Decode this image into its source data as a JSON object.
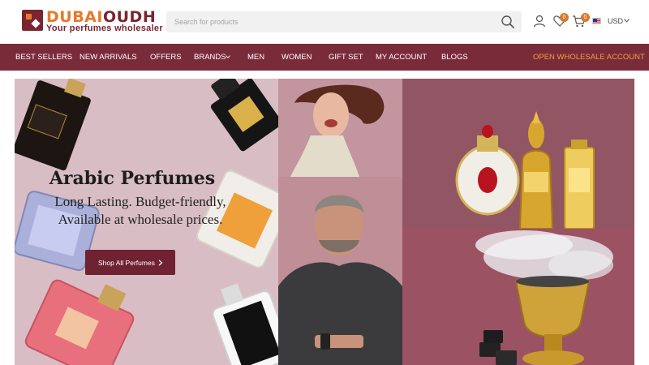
{
  "brand": {
    "name_part1": "DUBAI",
    "name_part2": "OUDH",
    "tagline": "Your perfumes wholesaler"
  },
  "search": {
    "placeholder": "Search for products"
  },
  "header": {
    "wishlist_count": "0",
    "cart_count": "0",
    "currency": "USD"
  },
  "nav": {
    "items": [
      "BEST SELLERS",
      "NEW ARRIVALS",
      "OFFERS",
      "BRANDS",
      "MEN",
      "WOMEN",
      "GIFT SET",
      "MY ACCOUNT",
      "BLOGS"
    ],
    "wholesale": "OPEN WHOLESALE ACCOUNT"
  },
  "hero": {
    "title": "Arabic Perfumes",
    "subtitle": "Long Lasting. Budget-friendly, Available at wholesale prices.",
    "cta": "Shop All Perfumes"
  },
  "icons": [
    "search-icon",
    "user-icon",
    "heart-icon",
    "cart-icon",
    "us-flag-icon",
    "chevron-down-icon",
    "chevron-right-icon"
  ],
  "colors": {
    "brand_primary": "#7a2b3a",
    "accent_orange": "#e8782a",
    "cta_bg": "#6e2232",
    "wholesale_link": "#f0a03a"
  }
}
